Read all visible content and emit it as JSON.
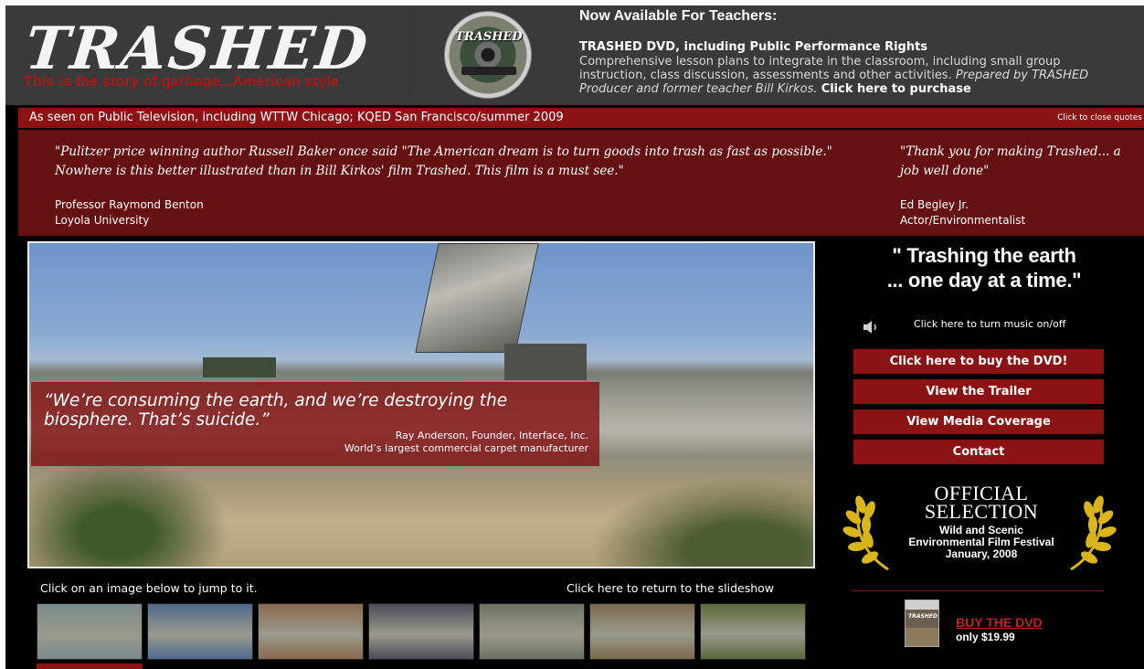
{
  "header": {
    "logo": "TRASHED",
    "tagline": "This is the story of garbage...American style",
    "dvd_disc_title": "TRASHED",
    "teachers_heading": "Now Available For Teachers:",
    "teachers_sub": "TRASHED DVD, including Public Performance Rights",
    "teachers_body": "Comprehensive lesson plans to integrate in the classroom, including small group instruction, class discussion, assessments and other activities.",
    "teachers_prepared": "Prepared by TRASHED Producer and former teacher Bill Kirkos.",
    "teachers_link": "Click here to purchase"
  },
  "quotes": {
    "bar_text": "As seen on Public Television, including WTTW Chicago; KQED San Francisco/summer 2009",
    "close_label": "Click to close quotes",
    "items": [
      {
        "text": "\"Pulitzer price winning author Russell Baker once said \"The American dream is to turn goods into trash as fast as possible.\" Nowhere is this better illustrated than in Bill Kirkos' film Trashed. This film is a must see.\"",
        "name": "Professor Raymond Benton",
        "affiliation": "Loyola University"
      },
      {
        "text": "\"Thank you for making Trashed... a job well done\"",
        "name": "Ed Begley Jr.",
        "affiliation": "Actor/Environmentalist"
      }
    ]
  },
  "slideshow": {
    "quote": "“We’re consuming the earth, and we’re destroying the biosphere. That’s suicide.”",
    "attr_line1": "Ray Anderson, Founder, Interface, Inc.",
    "attr_line2": "World’s largest commercial carpet manufacturer"
  },
  "thumbnails": {
    "hint": "Click on an image below to jump to it.",
    "return_label": "Click here to return to the slideshow",
    "colors": [
      "#7a8a8c",
      "#4d6a8c",
      "#8a6a4e",
      "#4a4d5a",
      "#6e7262",
      "#7a6a4e",
      "#5a6a3a"
    ]
  },
  "sidebar": {
    "slogan_line1": "\" Trashing the earth",
    "slogan_line2": "... one day at a time.\"",
    "music_toggle": "Click here to turn music on/off",
    "buttons": {
      "buy": "Click here to buy the DVD!",
      "trailer": "View the Trailer",
      "media": "View Media Coverage",
      "contact": "Contact"
    },
    "official_line1": "OFFICIAL",
    "official_line2": "SELECTION",
    "festival_line1": "Wild and Scenic",
    "festival_line2": "Environmental Film Festival",
    "festival_line3": "January, 2008",
    "dvd_cover_text": "TRASHED",
    "buy_link": "BUY THE DVD",
    "price": "only $19.99"
  },
  "colors": {
    "accent_red": "#8c1313",
    "quotes_panel": "#661111",
    "header_bg": "#3a3a3a",
    "laurel_gold": "#d9b51a"
  }
}
